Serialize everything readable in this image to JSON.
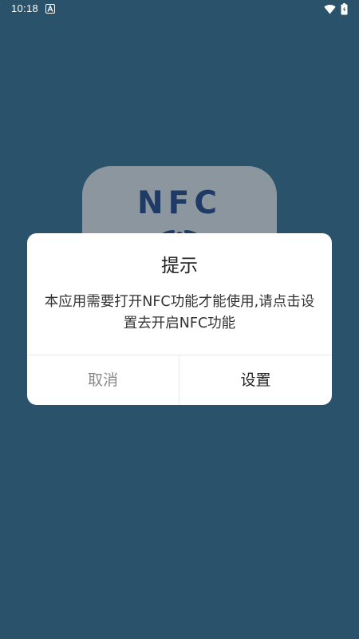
{
  "status_bar": {
    "time": "10:18",
    "app_notification_icon": "a-letter-icon",
    "wifi_icon": "wifi-icon",
    "battery_icon": "battery-icon"
  },
  "background_app": {
    "logo_text": "NFC",
    "logo_icon": "nfc-logo-icon"
  },
  "dialog": {
    "title": "提示",
    "message": "本应用需要打开NFC功能才能使用,请点击设置去开启NFC功能",
    "cancel_label": "取消",
    "settings_label": "设置"
  },
  "colors": {
    "background": "#2a526b",
    "logo_tile": "#8b969e",
    "logo_text": "#1f3a64",
    "dialog_bg": "#ffffff",
    "cancel_text": "#8a8a8a"
  }
}
